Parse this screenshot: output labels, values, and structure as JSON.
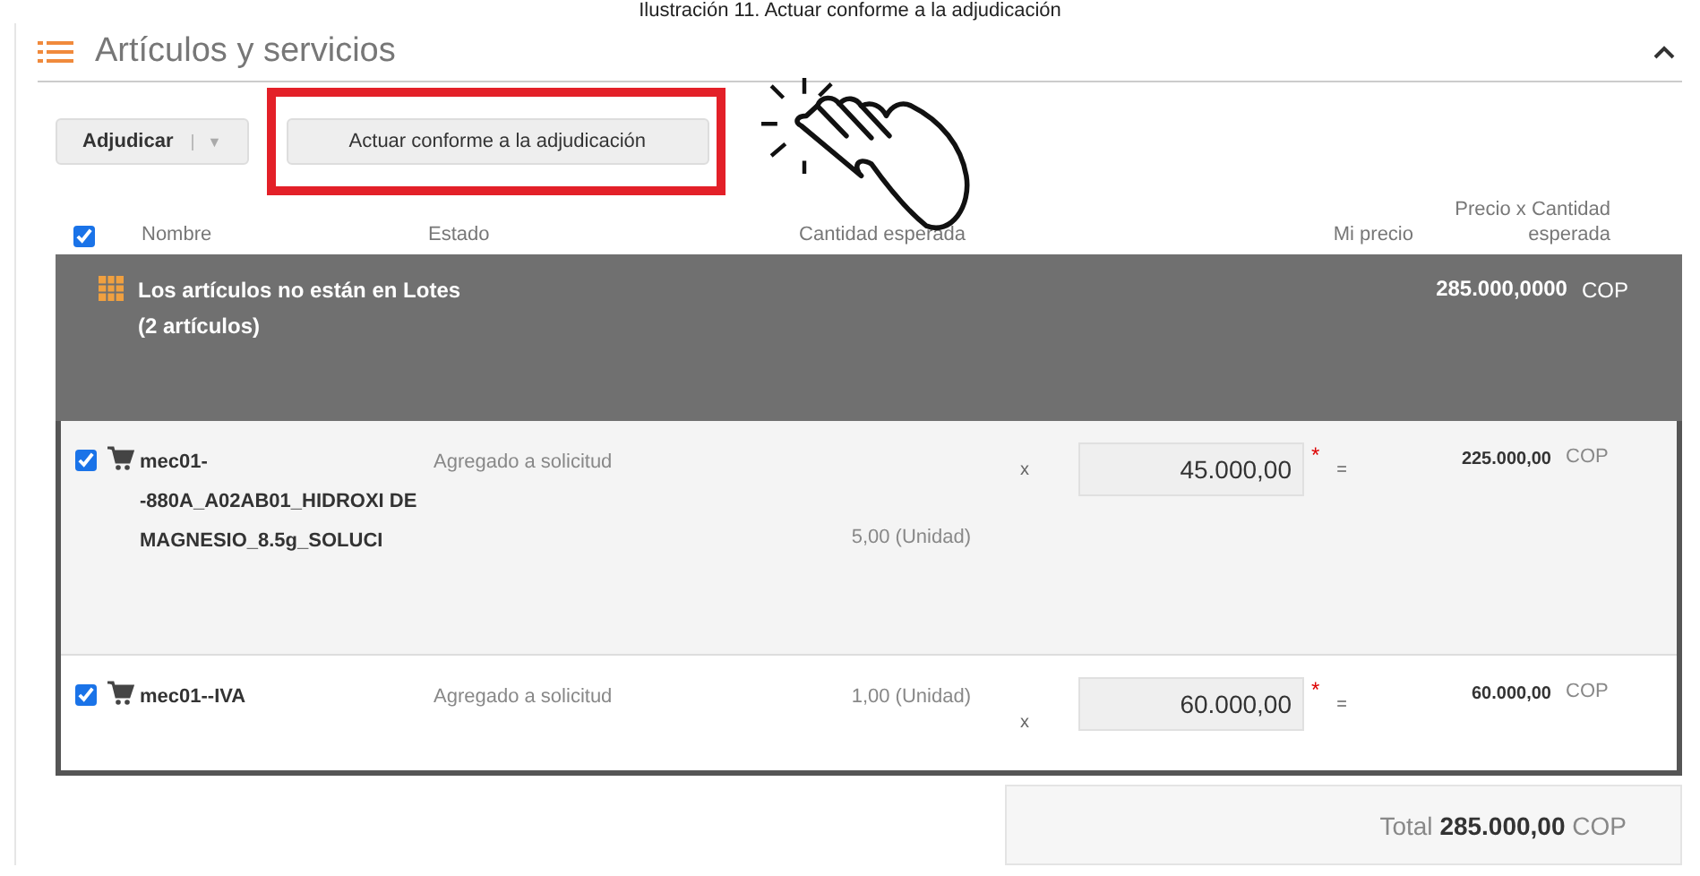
{
  "caption": "Ilustración 11. Actuar conforme a la adjudicación",
  "section": {
    "title": "Artículos y servicios",
    "expanded": true
  },
  "toolbar": {
    "award_button": "Adjudicar",
    "dropdown_caret": "▼",
    "act_button": "Actuar conforme a la adjudicación"
  },
  "table": {
    "select_all_checked": true,
    "columns": [
      "Nombre",
      "Estado",
      "Cantidad esperada",
      "Mi precio",
      "Precio x Cantidad esperada"
    ],
    "group": {
      "title": "Los artículos no están en Lotes (2 artículos)",
      "total": "285.000,0000",
      "currency": "COP"
    },
    "rows": [
      {
        "checked": true,
        "name": "mec01--880A_A02AB01_HIDROXI DE MAGNESIO_8.5g_SOLUCI",
        "status": "Agregado a solicitud",
        "quantity": "5,00 (Unidad)",
        "times": "x",
        "price": "45.000,00",
        "required": "*",
        "equals": "=",
        "line_total": "225.000,00",
        "currency": "COP"
      },
      {
        "checked": true,
        "name": "mec01--IVA",
        "status": "Agregado a solicitud",
        "quantity": "1,00 (Unidad)",
        "times": "x",
        "price": "60.000,00",
        "required": "*",
        "equals": "=",
        "line_total": "60.000,00",
        "currency": "COP"
      }
    ]
  },
  "total": {
    "label": "Total",
    "amount": "285.000,00",
    "currency": "COP"
  }
}
